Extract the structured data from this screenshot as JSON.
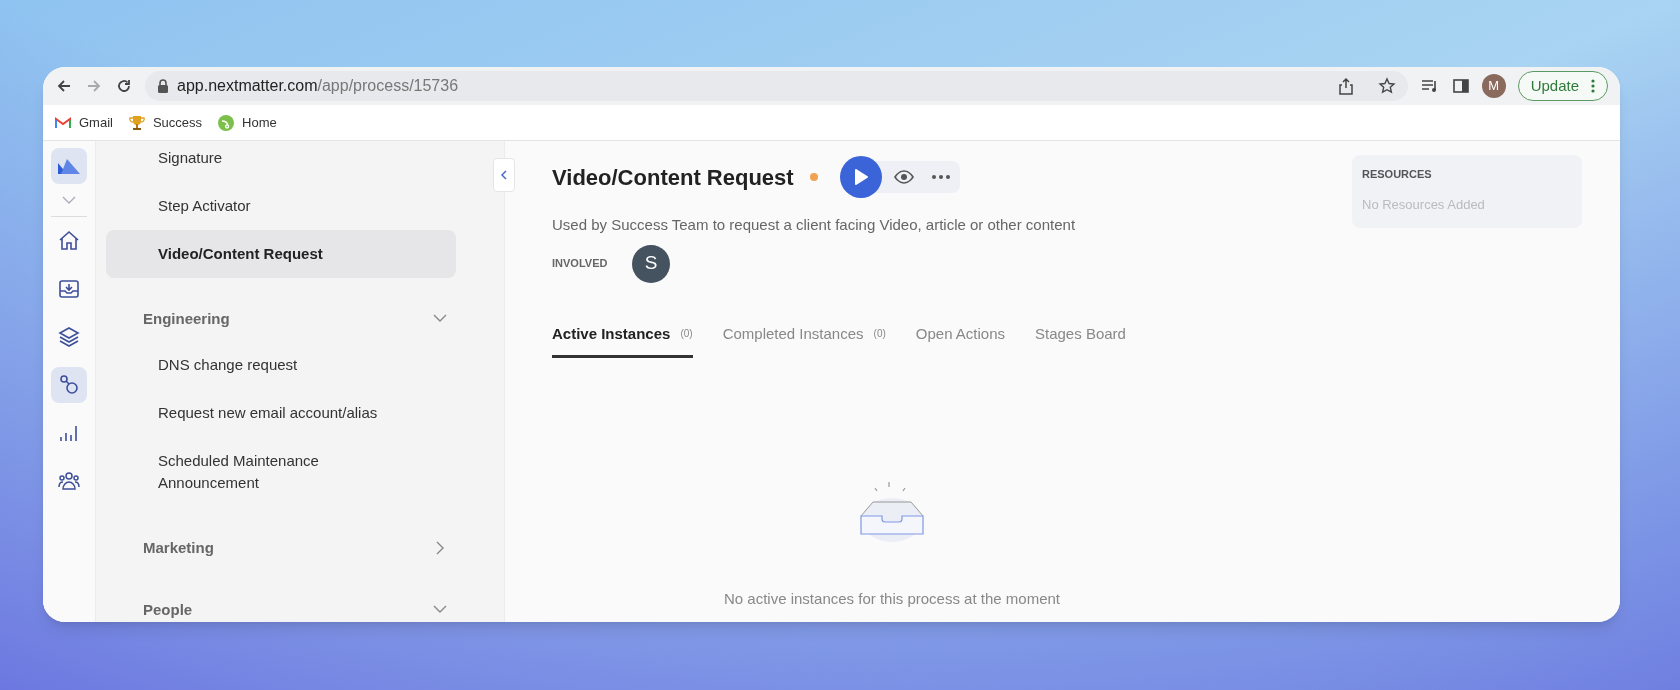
{
  "browser": {
    "url": {
      "host": "app.nextmatter.com",
      "path": "/app/process/15736"
    },
    "profile": "M",
    "update_button": "Update"
  },
  "bookmarks": [
    {
      "label": "Gmail"
    },
    {
      "label": "Success"
    },
    {
      "label": "Home"
    }
  ],
  "rail": [
    {
      "selected": false
    },
    {
      "selected": false
    },
    {
      "selected": false
    },
    {
      "selected": true
    },
    {
      "selected": false
    },
    {
      "selected": false
    }
  ],
  "sidebar": [
    {
      "kind": "item",
      "label": "Signature",
      "selected": false
    },
    {
      "kind": "item",
      "label": "Step Activator",
      "selected": false
    },
    {
      "kind": "item",
      "label": "Video/Content Request",
      "selected": true
    },
    {
      "kind": "group",
      "label": "Engineering",
      "expanded": true,
      "children": [
        {
          "label": "DNS change request",
          "selected": false
        },
        {
          "label": "Request new email account/alias",
          "selected": false
        },
        {
          "label": "Scheduled Maintenance Announcement",
          "selected": false
        }
      ]
    },
    {
      "kind": "group",
      "label": "Marketing",
      "expanded": false
    },
    {
      "kind": "group",
      "label": "People",
      "expanded": true
    }
  ],
  "process": {
    "title": "Video/Content Request",
    "description": "Used by Success Team to request a client facing Video, article or other content",
    "involved_label": "INVOLVED",
    "involved": [
      "S"
    ]
  },
  "tabs": [
    {
      "label": "Active Instances",
      "count": "(0)",
      "selected": true
    },
    {
      "label": "Completed Instances",
      "count": "(0)",
      "selected": false
    },
    {
      "label": "Open Actions",
      "selected": false
    },
    {
      "label": "Stages Board",
      "selected": false
    }
  ],
  "empty_state": "No active instances for this process at the moment",
  "resources": {
    "title": "RESOURCES",
    "empty": "No Resources Added"
  }
}
